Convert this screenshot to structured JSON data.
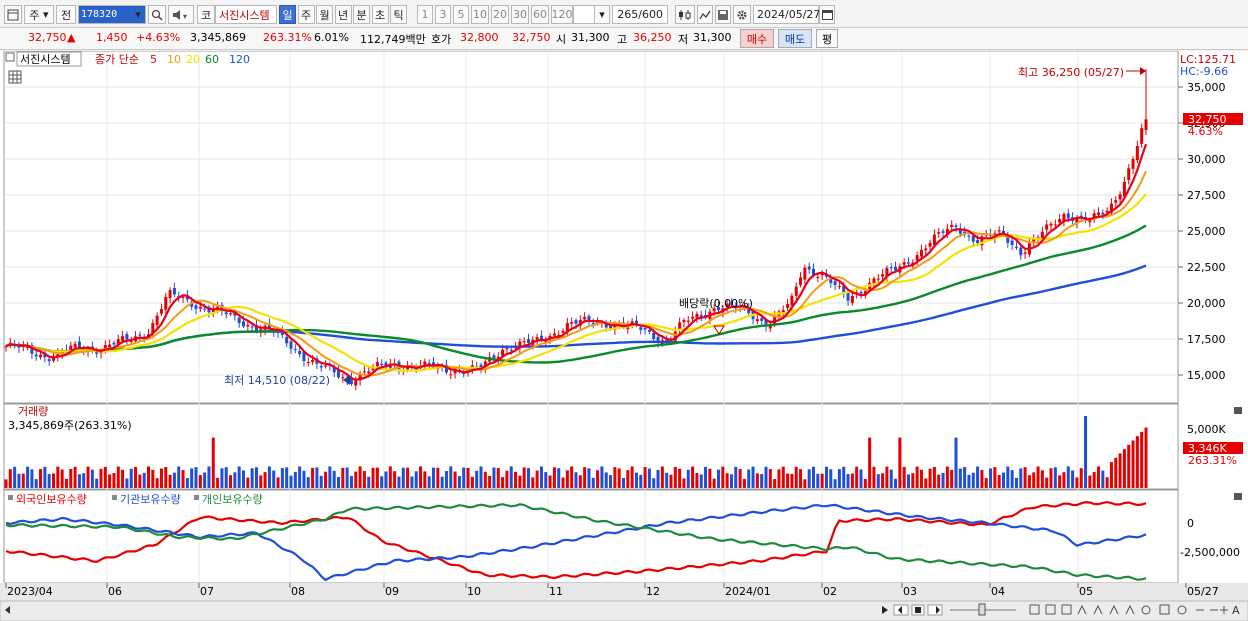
{
  "toolbar": {
    "menu_icon": "window-icon",
    "type_label": "주",
    "prev_label": "전",
    "code": "178320",
    "mode_label": "코",
    "name": "서진시스템",
    "periods": [
      "일",
      "주",
      "월",
      "년",
      "분",
      "초",
      "틱"
    ],
    "active_period": "일",
    "intervals": [
      "1",
      "3",
      "5",
      "10",
      "20",
      "30",
      "60",
      "120"
    ],
    "count": "265",
    "count_total": "/600",
    "date": "2024/05/27"
  },
  "quote": {
    "price": "32,750",
    "arrow": "▲",
    "change": "1,450",
    "change_pct": "+4.63%",
    "volume": "3,345,869",
    "volume_ratio": "263.31%",
    "turnover": "6.01%",
    "amount": "112,749백만",
    "ask_label": "호가",
    "ask": "32,800",
    "bid": "32,750",
    "open_label": "시",
    "open": "31,300",
    "high_label": "고",
    "high": "36,250",
    "low_label": "저",
    "low": "31,300",
    "buy_label": "매수",
    "sell_label": "매도",
    "eval_label": "평"
  },
  "price_panel": {
    "stock_tag": "서진시스템",
    "legend_prefix": "종가 단순",
    "ma_labels": [
      "5",
      "10",
      "20",
      "60",
      "120"
    ],
    "ma_colors": [
      "#e8001c",
      "#f39c12",
      "#f5e200",
      "#0a8a2a",
      "#1f4fd8"
    ],
    "lc": "LC:125.71",
    "hc": "HC:-9.66",
    "high_note": "최고 36,250 (05/27)",
    "low_note": "최저 14,510 (08/22)",
    "dividend_note": "배당락(0.00%)",
    "price_tag": "32,750",
    "pct_tag": "4.63%",
    "y_ticks": [
      "35,000",
      "32,500",
      "30,000",
      "27,500",
      "25,000",
      "22,500",
      "20,000",
      "17,500",
      "15,000"
    ]
  },
  "volume_panel": {
    "title": "거래량",
    "value": "3,345,869주(263.31%)",
    "y_tick": "5,000K",
    "tag": "3,346K",
    "tag_pct": "263.31%"
  },
  "holding_panel": {
    "series": [
      "외국인보유수량",
      "기관보유수량",
      "개인보유수량"
    ],
    "colors": [
      "#e60000",
      "#1f4fd8",
      "#1e8a3c"
    ],
    "y_ticks": [
      "0",
      "-2,500,000"
    ]
  },
  "x_axis": [
    "2023/04",
    "06",
    "07",
    "08",
    "09",
    "10",
    "11",
    "12",
    "2024/01",
    "02",
    "03",
    "04",
    "05",
    "05/27"
  ]
}
